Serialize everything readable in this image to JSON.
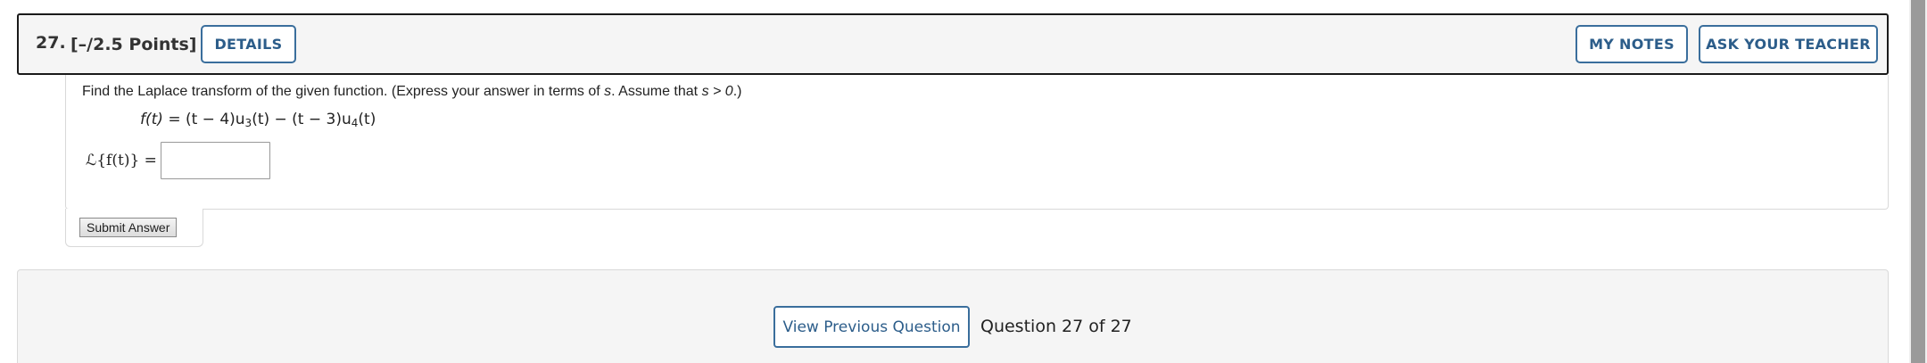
{
  "header": {
    "number": "27.",
    "points": "[–/2.5 Points]",
    "details_label": "DETAILS",
    "notes_label": "MY NOTES",
    "teacher_label": "ASK YOUR TEACHER"
  },
  "question": {
    "prompt_before": "Find the Laplace transform of the given function. (Express your answer in terms of ",
    "prompt_var": "s",
    "prompt_middle": ". Assume that ",
    "prompt_condition": "s > 0",
    "prompt_after": ".)",
    "function": {
      "lhs": "f(t)",
      "part1": " = (t − 4)u",
      "sub1": "3",
      "part2": "(t) − (t − 3)u",
      "sub2": "4",
      "part3": "(t)"
    },
    "answer_label": "ℒ{f(t)} =",
    "answer_value": ""
  },
  "submit": {
    "label": "Submit Answer"
  },
  "navigation": {
    "prev_label": "View Previous Question",
    "counter": "Question 27 of 27"
  }
}
